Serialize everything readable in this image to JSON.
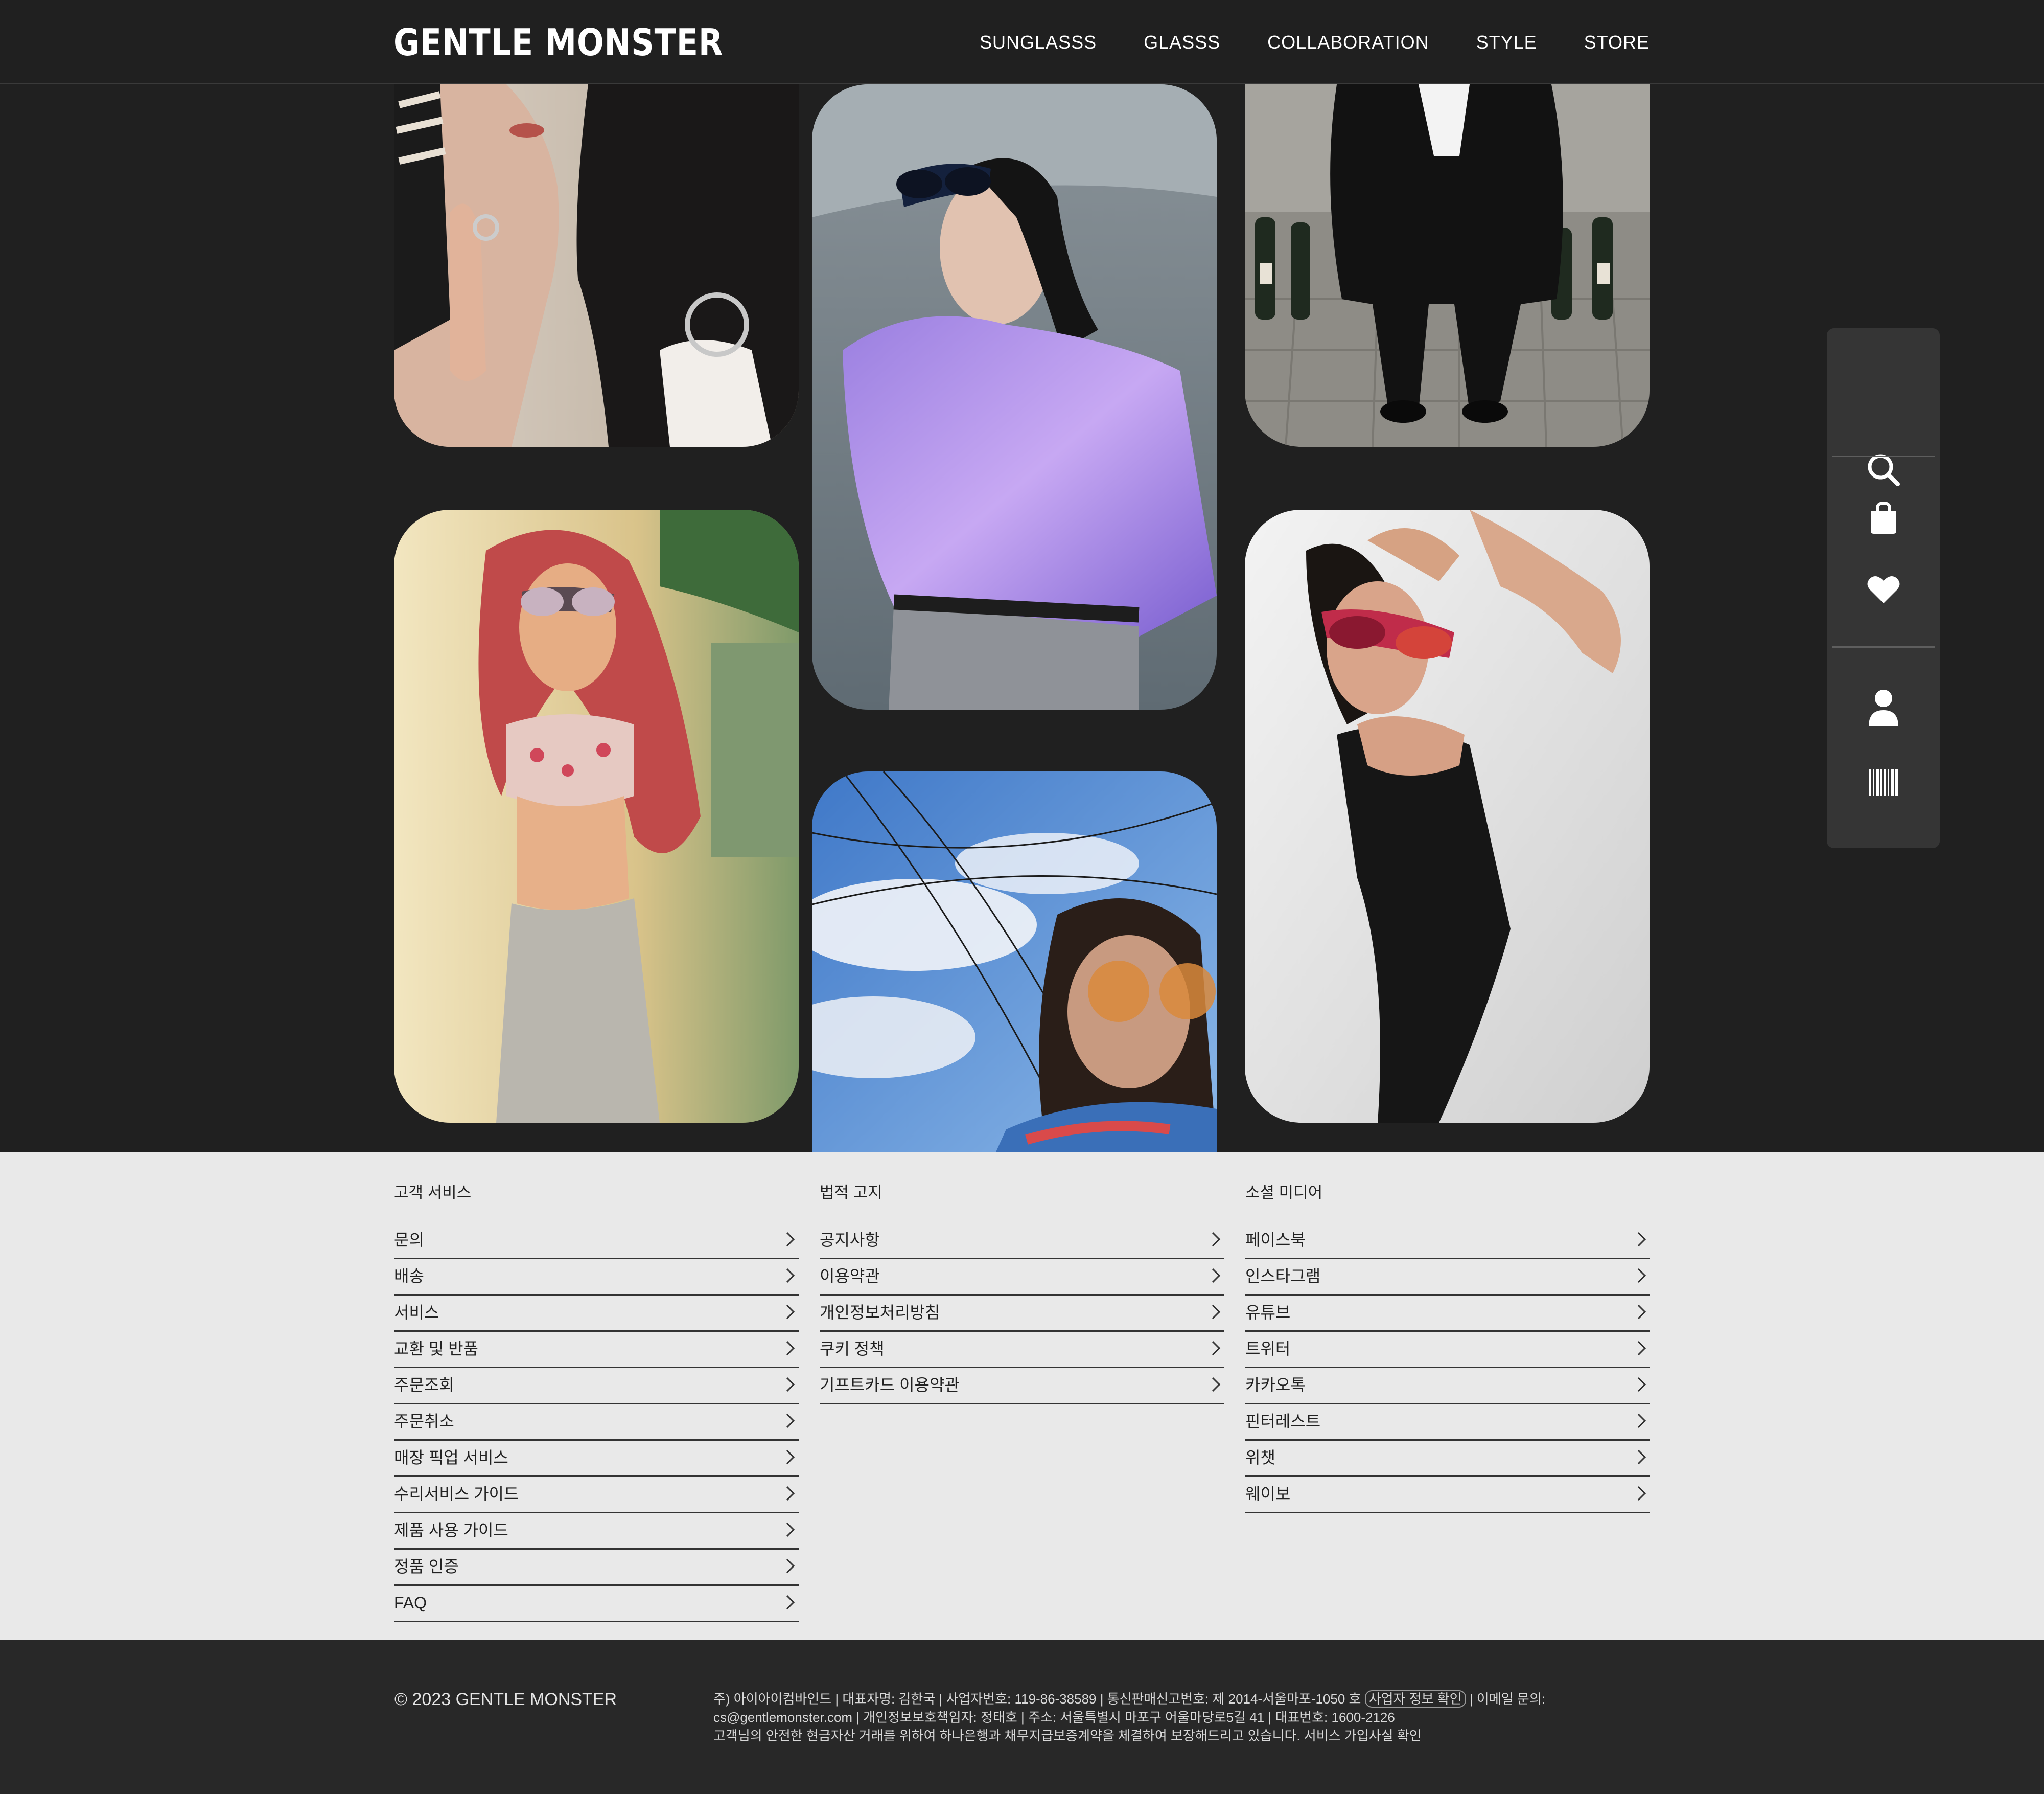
{
  "header": {
    "logo": "GENTLE MONSTER",
    "nav": [
      "SUNGLASSS",
      "GLASSS",
      "COLLABORATION",
      "STYLE",
      "STORE"
    ]
  },
  "gallery": {
    "photos": [
      {
        "subject": "woman taking mirror selfie with phone, black leather vest"
      },
      {
        "subject": "woman in purple satin shirt wearing blue sunglasses"
      },
      {
        "subject": "person in black suit standing among bottles"
      },
      {
        "subject": "woman with long red hair wearing cat-eye sunglasses"
      },
      {
        "subject": "person with orange-tinted glasses under blue sky"
      },
      {
        "subject": "woman in black slip dress with pink sport sunglasses"
      }
    ]
  },
  "side_dock": {
    "icons": [
      "search-icon",
      "bag-icon",
      "heart-icon",
      "user-icon",
      "barcode-icon"
    ]
  },
  "footer": {
    "columns": [
      {
        "title": "고객 서비스",
        "links": [
          "문의",
          "배송",
          "서비스",
          "교환 및 반품",
          "주문조회",
          "주문취소",
          "매장 픽업 서비스",
          "수리서비스 가이드",
          "제품 사용 가이드",
          "정품 인증",
          "FAQ"
        ]
      },
      {
        "title": "법적 고지",
        "links": [
          "공지사항",
          "이용약관",
          "개인정보처리방침",
          "쿠키 정책",
          "기프트카드 이용약관"
        ]
      },
      {
        "title": "소셜 미디어",
        "links": [
          "페이스북",
          "인스타그램",
          "유튜브",
          "트위터",
          "카카오톡",
          "핀터레스트",
          "위챗",
          "웨이보"
        ]
      }
    ],
    "copyright": "© 2023 GENTLE MONSTER",
    "legal": {
      "line1_a": "주) 아이아이컴바인드 | 대표자명: 김한국 | 사업자번호: 119-86-38589 | 통신판매신고번호: 제 2014-서울마포-1050 호",
      "business_info_link": "사업자 정보 확인",
      "line1_b": "| 이메일 문의:",
      "line2": "cs@gentlemonster.com | 개인정보보호책임자: 정태호 | 주소: 서울특별시 마포구 어울마당로5길 41 | 대표번호: 1600-2126",
      "line3": "고객님의 안전한 현금자산 거래를 위하여 하나은행과 채무지급보증계약을 체결하여 보장해드리고 있습니다. 서비스 가입사실 확인"
    }
  }
}
